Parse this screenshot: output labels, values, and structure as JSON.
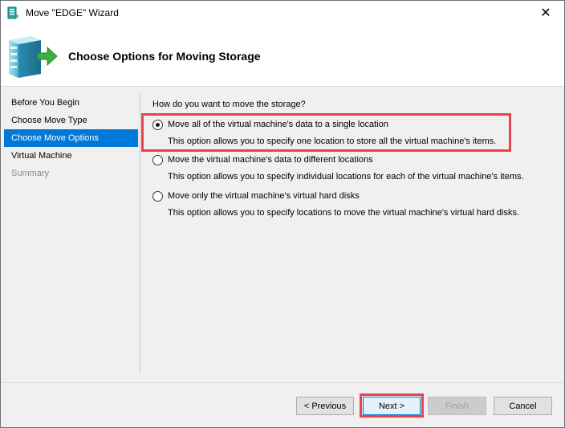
{
  "window": {
    "title": "Move \"EDGE\" Wizard",
    "close_glyph": "✕"
  },
  "header": {
    "title": "Choose Options for Moving Storage"
  },
  "nav": {
    "items": [
      {
        "label": "Before You Begin",
        "state": "normal"
      },
      {
        "label": "Choose Move Type",
        "state": "normal"
      },
      {
        "label": "Choose Move Options",
        "state": "active"
      },
      {
        "label": "Virtual Machine",
        "state": "normal"
      },
      {
        "label": "Summary",
        "state": "disabled"
      }
    ]
  },
  "content": {
    "question": "How do you want to move the storage?",
    "options": [
      {
        "label": "Move all of the virtual machine's data to a single location",
        "description": "This option allows you to specify one location to store all the virtual machine's items.",
        "checked": true
      },
      {
        "label": "Move the virtual machine's data to different locations",
        "description": "This option allows you to specify individual locations for each of the virtual machine's items.",
        "checked": false
      },
      {
        "label": "Move only the virtual machine's virtual hard disks",
        "description": "This option allows you to specify locations to move the virtual machine's virtual hard disks.",
        "checked": false
      }
    ]
  },
  "buttons": {
    "previous": "< Previous",
    "next": "Next >",
    "finish": "Finish",
    "cancel": "Cancel"
  },
  "colors": {
    "accent": "#0078d7",
    "highlight": "#e8434d"
  }
}
